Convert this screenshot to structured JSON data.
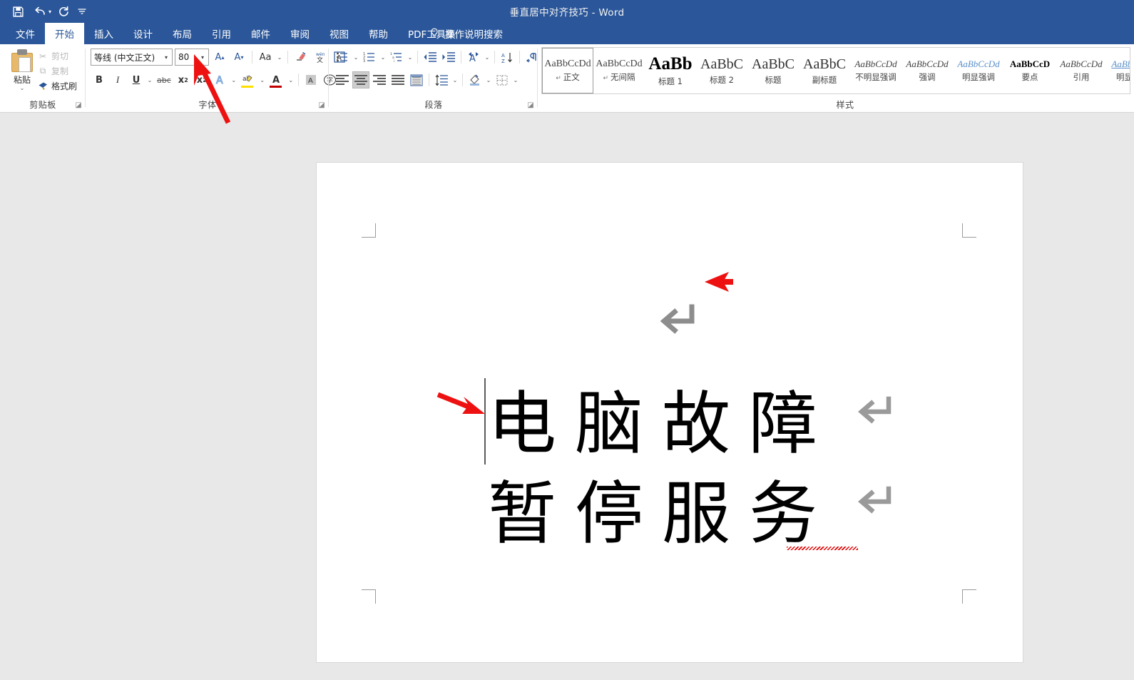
{
  "window": {
    "title": "垂直居中对齐技巧  -  Word",
    "quick_access": [
      {
        "name": "save-icon",
        "glyph": "💾"
      },
      {
        "name": "undo-icon",
        "glyph": "↶"
      },
      {
        "name": "redo-icon",
        "glyph": "↻"
      },
      {
        "name": "customize-qat-icon",
        "glyph": "☰"
      }
    ],
    "accent_color": "#2b579a"
  },
  "ribbon": {
    "tabs": [
      {
        "label": "文件",
        "active": false
      },
      {
        "label": "开始",
        "active": true
      },
      {
        "label": "插入",
        "active": false
      },
      {
        "label": "设计",
        "active": false
      },
      {
        "label": "布局",
        "active": false
      },
      {
        "label": "引用",
        "active": false
      },
      {
        "label": "邮件",
        "active": false
      },
      {
        "label": "审阅",
        "active": false
      },
      {
        "label": "视图",
        "active": false
      },
      {
        "label": "帮助",
        "active": false
      },
      {
        "label": "PDF工具集",
        "active": false
      }
    ],
    "tell_me": "操作说明搜索",
    "groups": {
      "clipboard": {
        "label": "剪贴板",
        "paste_label": "粘贴",
        "commands": [
          {
            "label": "剪切",
            "icon": "scissors-icon",
            "glyph": "✂",
            "enabled": false
          },
          {
            "label": "复制",
            "icon": "copy-icon",
            "glyph": "⧉",
            "enabled": false
          },
          {
            "label": "格式刷",
            "icon": "format-painter-icon",
            "glyph": "✒",
            "enabled": true
          }
        ]
      },
      "font": {
        "label": "字体",
        "font_name": "等线 (中文正文)",
        "font_size": "80",
        "buttons_row1": [
          {
            "name": "grow-font-button",
            "glyph": "A▴"
          },
          {
            "name": "shrink-font-button",
            "glyph": "A▾"
          },
          {
            "name": "change-case-button",
            "glyph": "Aa"
          },
          {
            "name": "clear-formatting-button",
            "glyph": "✐"
          },
          {
            "name": "phonetic-guide-button",
            "glyph": "文"
          },
          {
            "name": "character-border-button",
            "glyph": "A"
          }
        ],
        "buttons_row2": [
          {
            "name": "bold-button",
            "glyph": "B"
          },
          {
            "name": "italic-button",
            "glyph": "I"
          },
          {
            "name": "underline-button",
            "glyph": "U"
          },
          {
            "name": "strikethrough-button",
            "glyph": "abc"
          },
          {
            "name": "subscript-button",
            "glyph": "x₂"
          },
          {
            "name": "superscript-button",
            "glyph": "x²"
          },
          {
            "name": "text-effects-button",
            "glyph": "A"
          },
          {
            "name": "text-highlight-color-button",
            "glyph": "ab"
          },
          {
            "name": "font-color-button",
            "glyph": "A"
          },
          {
            "name": "character-shading-button",
            "glyph": "A"
          },
          {
            "name": "enclose-character-button",
            "glyph": "字"
          }
        ],
        "highlight_color": "#ffdf00",
        "font_color": "#c00000"
      },
      "paragraph": {
        "label": "段落",
        "buttons_row1": [
          {
            "name": "bullets-button",
            "glyph": "•≡"
          },
          {
            "name": "numbering-button",
            "glyph": "1≡"
          },
          {
            "name": "multilevel-list-button",
            "glyph": "≡"
          },
          {
            "name": "decrease-indent-button",
            "glyph": "⇤"
          },
          {
            "name": "increase-indent-button",
            "glyph": "⇥"
          },
          {
            "name": "asian-layout-button",
            "glyph": "⩛"
          },
          {
            "name": "sort-button",
            "glyph": "A↓"
          },
          {
            "name": "show-formatting-marks-button",
            "glyph": "¶"
          }
        ],
        "align_selected": "center",
        "buttons_row2": [
          {
            "name": "align-left-button"
          },
          {
            "name": "align-center-button"
          },
          {
            "name": "align-right-button"
          },
          {
            "name": "justify-button"
          },
          {
            "name": "distribute-button"
          },
          {
            "name": "line-spacing-button",
            "glyph": "↕≡"
          },
          {
            "name": "shading-button",
            "glyph": "◢"
          },
          {
            "name": "borders-button",
            "glyph": "▦"
          }
        ]
      },
      "styles": {
        "label": "样式",
        "items": [
          {
            "preview": "AaBbCcDd",
            "name": "正文",
            "pilcrow": true,
            "selected": true,
            "style": "body"
          },
          {
            "preview": "AaBbCcDd",
            "name": "无间隔",
            "pilcrow": true,
            "selected": false,
            "style": "body"
          },
          {
            "preview": "AaBb",
            "name": "标题 1",
            "pilcrow": false,
            "selected": false,
            "style": "h1"
          },
          {
            "preview": "AaBbC",
            "name": "标题 2",
            "pilcrow": false,
            "selected": false,
            "style": "h2"
          },
          {
            "preview": "AaBbC",
            "name": "标题",
            "pilcrow": false,
            "selected": false,
            "style": "h3"
          },
          {
            "preview": "AaBbC",
            "name": "副标题",
            "pilcrow": false,
            "selected": false,
            "style": "h4"
          },
          {
            "preview": "AaBbCcDd",
            "name": "不明显强调",
            "pilcrow": false,
            "selected": false,
            "style": "em"
          },
          {
            "preview": "AaBbCcDd",
            "name": "强调",
            "pilcrow": false,
            "selected": false,
            "style": "em"
          },
          {
            "preview": "AaBbCcDd",
            "name": "明显强调",
            "pilcrow": false,
            "selected": false,
            "style": "em-blue"
          },
          {
            "preview": "AaBbCcD",
            "name": "要点",
            "pilcrow": false,
            "selected": false,
            "style": "strong"
          },
          {
            "preview": "AaBbCcDd",
            "name": "引用",
            "pilcrow": false,
            "selected": false,
            "style": "em"
          },
          {
            "preview": "AaBbCcDd",
            "name": "明显引用",
            "pilcrow": false,
            "selected": false,
            "style": "em-blue-u"
          }
        ]
      }
    }
  },
  "document": {
    "lines": [
      {
        "text": "电脑故障",
        "pilcrow": "↵"
      },
      {
        "text": "暂停服务",
        "pilcrow": "↵"
      }
    ],
    "empty_paragraph_mark": "↵",
    "misspelled_word": "务",
    "caret_visible": true,
    "annotations": [
      {
        "name": "arrow-to-font-size",
        "color": "#ee1111"
      },
      {
        "name": "arrow-to-empty-paragraph",
        "color": "#ee1111"
      },
      {
        "name": "arrow-to-caret",
        "color": "#ee1111"
      }
    ]
  }
}
